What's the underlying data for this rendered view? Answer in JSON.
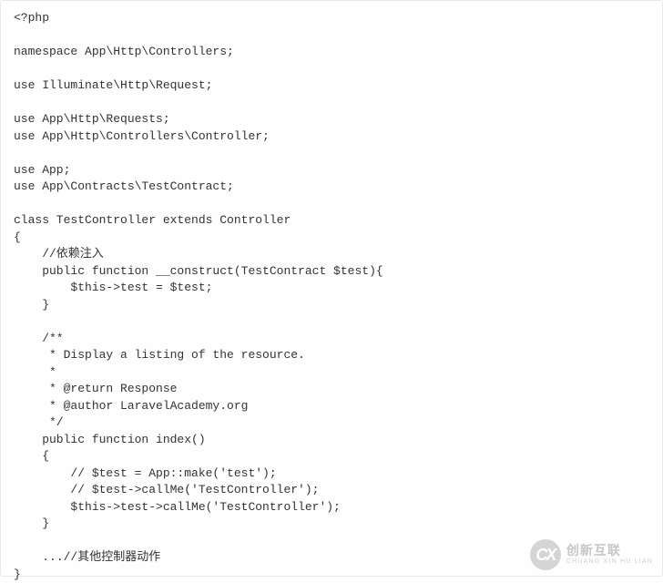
{
  "code": {
    "lines": [
      "<?php",
      "",
      "namespace App\\Http\\Controllers;",
      "",
      "use Illuminate\\Http\\Request;",
      "",
      "use App\\Http\\Requests;",
      "use App\\Http\\Controllers\\Controller;",
      "",
      "use App;",
      "use App\\Contracts\\TestContract;",
      "",
      "class TestController extends Controller",
      "{",
      "    //依赖注入",
      "    public function __construct(TestContract $test){",
      "        $this->test = $test;",
      "    }",
      "",
      "    /**",
      "     * Display a listing of the resource.",
      "     *",
      "     * @return Response",
      "     * @author LaravelAcademy.org",
      "     */",
      "    public function index()",
      "    {",
      "        // $test = App::make('test');",
      "        // $test->callMe('TestController');",
      "        $this->test->callMe('TestController');",
      "    }",
      "",
      "    ...//其他控制器动作",
      "}"
    ]
  },
  "watermark": {
    "icon_text": "CX",
    "cn": "创新互联",
    "pinyin": "CHUANG XIN HU LIAN"
  }
}
